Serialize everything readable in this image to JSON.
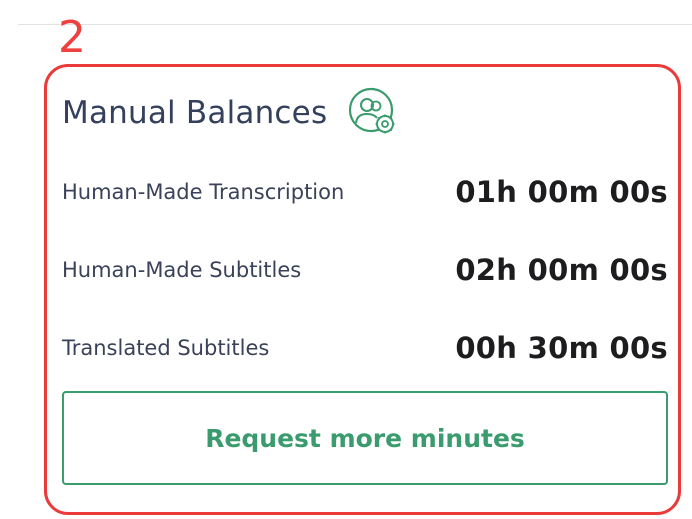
{
  "annotation": {
    "number": "2",
    "color": "#ea3a3a"
  },
  "card": {
    "title": "Manual Balances",
    "title_icon": "users-settings-icon",
    "balances": [
      {
        "label": "Human-Made Transcription",
        "value": "01h 00m 00s"
      },
      {
        "label": "Human-Made Subtitles",
        "value": "02h 00m 00s"
      },
      {
        "label": "Translated Subtitles",
        "value": "00h 30m 00s"
      }
    ],
    "request_button_label": "Request more minutes",
    "accent_color": "#3a9b6e"
  }
}
